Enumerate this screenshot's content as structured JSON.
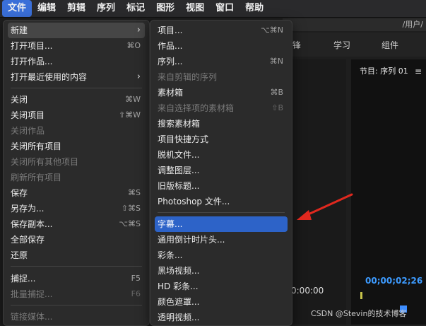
{
  "menubar": {
    "items": [
      "文件",
      "编辑",
      "剪辑",
      "序列",
      "标记",
      "图形",
      "视图",
      "窗口",
      "帮助"
    ]
  },
  "background": {
    "path": "/用户/",
    "tabs": [
      "锋",
      "学习",
      "组件"
    ],
    "program_title": "节目: 序列 01",
    "hamburger": "≡",
    "timecode": "00;00;02;26",
    "timecode_left": "0:00:00",
    "watermark": "CSDN @Stevin的技术博客"
  },
  "main_menu": {
    "items": [
      {
        "label": "新建",
        "shortcut": "",
        "submenu": true,
        "disabled": false
      },
      {
        "label": "打开项目...",
        "shortcut": "⌘O",
        "disabled": false
      },
      {
        "label": "打开作品...",
        "shortcut": "",
        "disabled": false
      },
      {
        "label": "打开最近使用的内容",
        "shortcut": "",
        "submenu": true,
        "disabled": false
      },
      {
        "label": "关闭",
        "shortcut": "⌘W",
        "disabled": false
      },
      {
        "label": "关闭项目",
        "shortcut": "⇧⌘W",
        "disabled": false
      },
      {
        "label": "关闭作品",
        "shortcut": "",
        "disabled": true
      },
      {
        "label": "关闭所有项目",
        "shortcut": "",
        "disabled": false
      },
      {
        "label": "关闭所有其他项目",
        "shortcut": "",
        "disabled": true
      },
      {
        "label": "刷新所有项目",
        "shortcut": "",
        "disabled": true
      },
      {
        "label": "保存",
        "shortcut": "⌘S",
        "disabled": false
      },
      {
        "label": "另存为...",
        "shortcut": "⇧⌘S",
        "disabled": false
      },
      {
        "label": "保存副本...",
        "shortcut": "⌥⌘S",
        "disabled": false
      },
      {
        "label": "全部保存",
        "shortcut": "",
        "disabled": false
      },
      {
        "label": "还原",
        "shortcut": "",
        "disabled": false
      },
      {
        "label": "捕捉...",
        "shortcut": "F5",
        "disabled": false
      },
      {
        "label": "批量捕捉...",
        "shortcut": "F6",
        "disabled": true
      },
      {
        "label": "链接媒体...",
        "shortcut": "",
        "disabled": true
      }
    ]
  },
  "sub_menu": {
    "items": [
      {
        "label": "项目...",
        "shortcut": "⌥⌘N",
        "disabled": false
      },
      {
        "label": "作品...",
        "shortcut": "",
        "disabled": false
      },
      {
        "label": "序列...",
        "shortcut": "⌘N",
        "disabled": false
      },
      {
        "label": "来自剪辑的序列",
        "shortcut": "",
        "disabled": true
      },
      {
        "label": "素材箱",
        "shortcut": "⌘B",
        "disabled": false
      },
      {
        "label": "来自选择项的素材箱",
        "shortcut": "⇧B",
        "disabled": true
      },
      {
        "label": "搜索素材箱",
        "shortcut": "",
        "disabled": false
      },
      {
        "label": "项目快捷方式",
        "shortcut": "",
        "disabled": false
      },
      {
        "label": "脱机文件...",
        "shortcut": "",
        "disabled": false
      },
      {
        "label": "调整图层...",
        "shortcut": "",
        "disabled": false
      },
      {
        "label": "旧版标题...",
        "shortcut": "",
        "disabled": false
      },
      {
        "label": "Photoshop 文件...",
        "shortcut": "",
        "disabled": false
      },
      {
        "label": "字幕...",
        "shortcut": "",
        "disabled": false,
        "selected": true
      },
      {
        "label": "通用倒计时片头...",
        "shortcut": "",
        "disabled": false
      },
      {
        "label": "彩条...",
        "shortcut": "",
        "disabled": false
      },
      {
        "label": "黑场视频...",
        "shortcut": "",
        "disabled": false
      },
      {
        "label": "HD 彩条...",
        "shortcut": "",
        "disabled": false
      },
      {
        "label": "颜色遮罩...",
        "shortcut": "",
        "disabled": false
      },
      {
        "label": "透明视频...",
        "shortcut": "",
        "disabled": false
      }
    ]
  },
  "colors": {
    "selection_blue": "#2d63c8",
    "annotation_red": "#e0281e",
    "timecode_blue": "#3d9bff"
  }
}
